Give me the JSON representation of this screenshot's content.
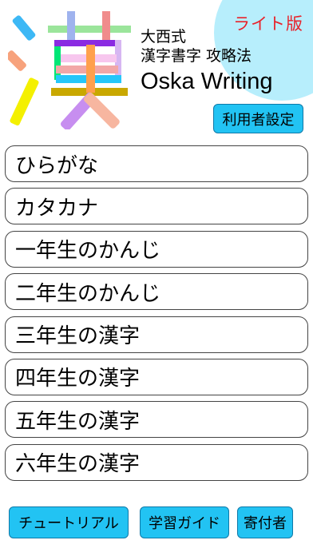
{
  "header": {
    "lite_badge": "ライト版",
    "logo_char": "漢",
    "subtitle_line1": "大西式",
    "subtitle_line2": "漢字書字 攻略法",
    "brand": "Oska Writing",
    "settings_label": "利用者設定"
  },
  "menu": {
    "items": [
      "ひらがな",
      "カタカナ",
      "一年生のかんじ",
      "二年生のかんじ",
      "三年生の漢字",
      "四年生の漢字",
      "五年生の漢字",
      "六年生の漢字"
    ]
  },
  "footer": {
    "tutorial_label": "チュートリアル",
    "guide_label": "学習ガイド",
    "donors_label": "寄付者"
  },
  "colors": {
    "accent_button": "#22c3f3",
    "corner_circle": "#b7eefc",
    "lite_badge": "#e8232b"
  }
}
